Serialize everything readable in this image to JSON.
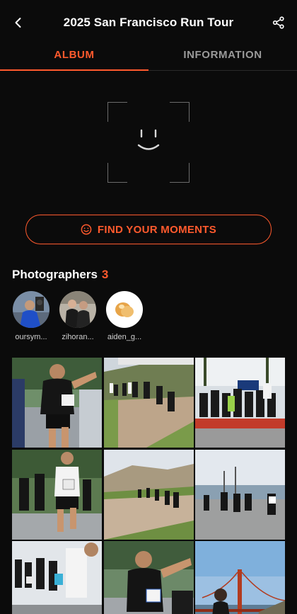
{
  "header": {
    "title": "2025 San Francisco Run Tour",
    "back_icon": "chevron-left-icon",
    "share_icon": "share-icon"
  },
  "tabs": [
    {
      "label": "ALBUM",
      "active": true
    },
    {
      "label": "INFORMATION",
      "active": false
    }
  ],
  "colors": {
    "accent": "#ff5a2d",
    "background": "#0b0b0b",
    "inactive_tab": "#9a9a9a"
  },
  "face_scan": {
    "icon": "face-scan-icon"
  },
  "find_button": {
    "label": "FIND YOUR MOMENTS",
    "icon": "smiley-icon"
  },
  "photographers": {
    "title": "Photographers",
    "count": "3",
    "items": [
      {
        "name": "oursym..."
      },
      {
        "name": "zihoran..."
      },
      {
        "name": "aiden_g..."
      }
    ]
  },
  "gallery": {
    "photos": [
      {
        "subject": "runner-closeup"
      },
      {
        "subject": "trail-runners"
      },
      {
        "subject": "group-photo"
      },
      {
        "subject": "runners-on-road"
      },
      {
        "subject": "coastal-trail"
      },
      {
        "subject": "runners-by-bay"
      },
      {
        "subject": "race-crowd"
      },
      {
        "subject": "runner-closeup"
      },
      {
        "subject": "golden-gate-bridge"
      }
    ]
  }
}
